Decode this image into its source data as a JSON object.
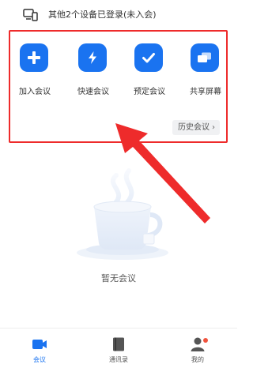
{
  "device_notice": {
    "text": "其他2个设备已登录(未入会)",
    "icon": "devices-icon"
  },
  "actions": [
    {
      "label": "加入会议",
      "icon": "plus-icon"
    },
    {
      "label": "快速会议",
      "icon": "lightning-icon"
    },
    {
      "label": "预定会议",
      "icon": "check-icon"
    },
    {
      "label": "共享屏幕",
      "icon": "screen-share-icon"
    }
  ],
  "history_button": {
    "label": "历史会议",
    "icon": "chevron-right-icon"
  },
  "empty_state": {
    "text": "暂无会议",
    "illustration": "coffee-cup-icon"
  },
  "bottom_nav": [
    {
      "label": "会议",
      "icon": "video-camera-icon",
      "active": true
    },
    {
      "label": "通讯录",
      "icon": "contacts-book-icon",
      "active": false
    },
    {
      "label": "我的",
      "icon": "person-icon",
      "active": false,
      "badge": true
    }
  ],
  "colors": {
    "accent": "#1a73f0",
    "highlight_border": "#ee2b2b",
    "arrow": "#ee2b2b",
    "badge": "#f0533d"
  }
}
